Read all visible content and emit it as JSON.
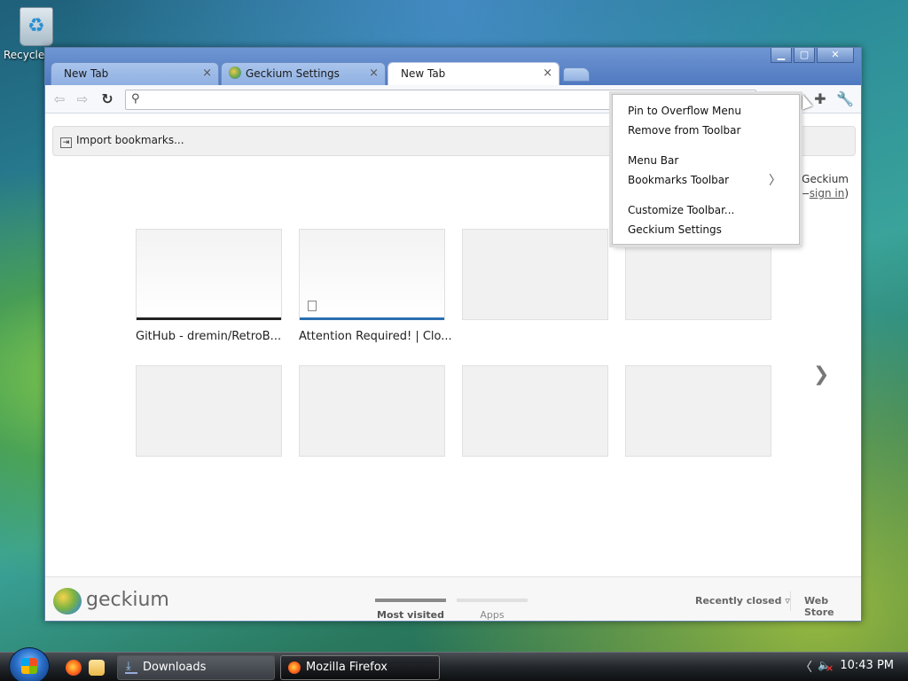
{
  "desktop": {
    "recycle_label": "Recycle"
  },
  "window": {
    "controls": {
      "minimize": "▁",
      "maximize": "▢",
      "close": "✕"
    },
    "tabs": [
      {
        "label": "New Tab",
        "close": "×"
      },
      {
        "label": "Geckium Settings",
        "close": "×"
      },
      {
        "label": "New Tab",
        "close": "×"
      }
    ]
  },
  "toolbar": {
    "back_icon": "⇦",
    "forward_icon": "⇨",
    "reload_icon": "↻",
    "search_icon": "⚲",
    "address_value": "",
    "extensions_icon": "✚",
    "wrench_icon": "🔧"
  },
  "bookmarks_bar": {
    "import_label": "Import bookmarks..."
  },
  "signin_promo": {
    "line1": "Geckium",
    "link": "sign in"
  },
  "most_visited": [
    {
      "title": "GitHub - dremin/RetroB...",
      "bar_color": "#222222"
    },
    {
      "title": "Attention Required! | Clo...",
      "bar_color": "#2b6fb0"
    }
  ],
  "next_arrow": "❯",
  "footer": {
    "logo_text": "geckium",
    "tabs": [
      {
        "label": "Most visited",
        "active": true
      },
      {
        "label": "Apps",
        "active": false
      }
    ],
    "recently_closed": "Recently closed ▿",
    "web_store": "Web Store"
  },
  "context_menu": {
    "items": [
      "Pin to Overflow Menu",
      "Remove from Toolbar",
      "Menu Bar",
      "Bookmarks Toolbar",
      "Customize Toolbar...",
      "Geckium Settings"
    ],
    "submenu_arrow": "〉"
  },
  "taskbar": {
    "tasks": [
      {
        "label": "Downloads"
      },
      {
        "label": "Mozilla Firefox"
      }
    ],
    "tray_arrow": "〈",
    "clock": "10:43 PM"
  }
}
